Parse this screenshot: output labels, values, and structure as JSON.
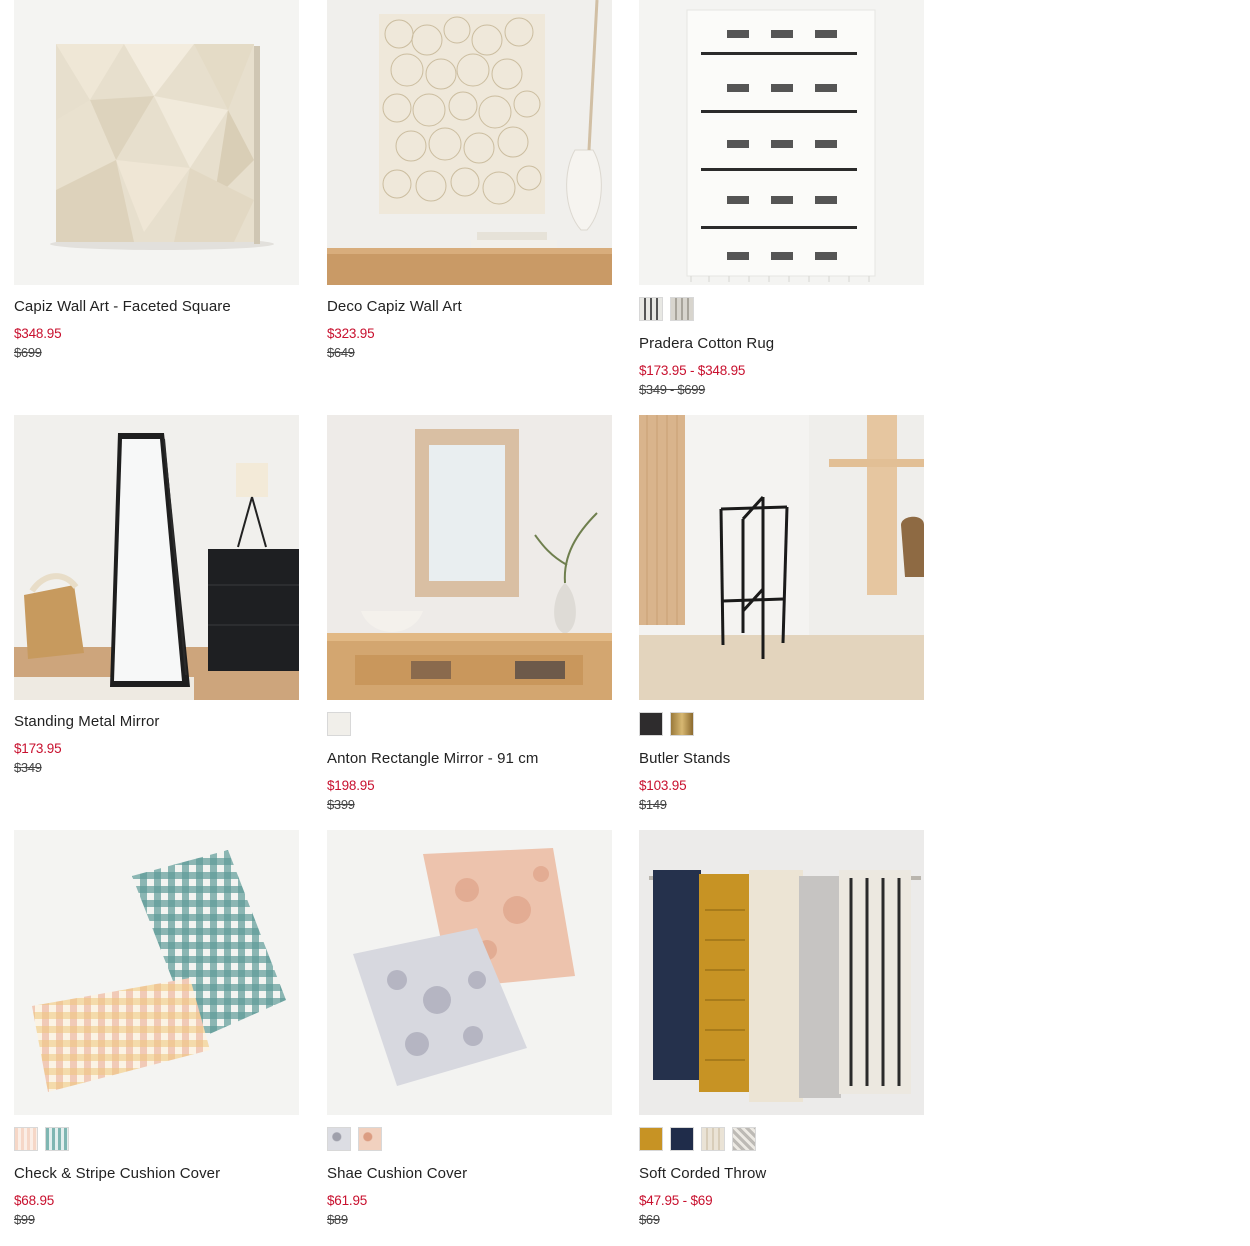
{
  "products": [
    {
      "name": "Capiz Wall Art - Faceted Square",
      "price": "$348.95",
      "was": "$699",
      "swatches": []
    },
    {
      "name": "Deco Capiz Wall Art",
      "price": "$323.95",
      "was": "$649",
      "swatches": []
    },
    {
      "name": "Pradera Cotton Rug",
      "price": "$173.95 - $348.95",
      "was": "$349 - $699",
      "swatches": [
        "black-white-pattern",
        "grey-pattern"
      ]
    },
    {
      "name": "Standing Metal Mirror",
      "price": "$173.95",
      "was": "$349",
      "swatches": []
    },
    {
      "name": "Anton Rectangle Mirror - 91 cm",
      "price": "$198.95",
      "was": "$399",
      "swatches": [
        "white-wash"
      ]
    },
    {
      "name": "Butler Stands",
      "price": "$103.95",
      "was": "$149",
      "swatches": [
        "black",
        "antique-brass"
      ]
    },
    {
      "name": "Check & Stripe Cushion Cover",
      "price": "$68.95",
      "was": "$99",
      "swatches": [
        "pink-check",
        "teal-check"
      ]
    },
    {
      "name": "Shae Cushion Cover",
      "price": "$61.95",
      "was": "$89",
      "swatches": [
        "grey-floral",
        "blush-floral"
      ]
    },
    {
      "name": "Soft Corded Throw",
      "price": "$47.95 - $69",
      "was": "$69",
      "swatches": [
        "dark-horseradish",
        "navy",
        "natural",
        "grey-stripe"
      ]
    }
  ],
  "colors": {
    "sale_price": "#c8102e",
    "name_text": "#222222",
    "was_price": "#444444"
  }
}
